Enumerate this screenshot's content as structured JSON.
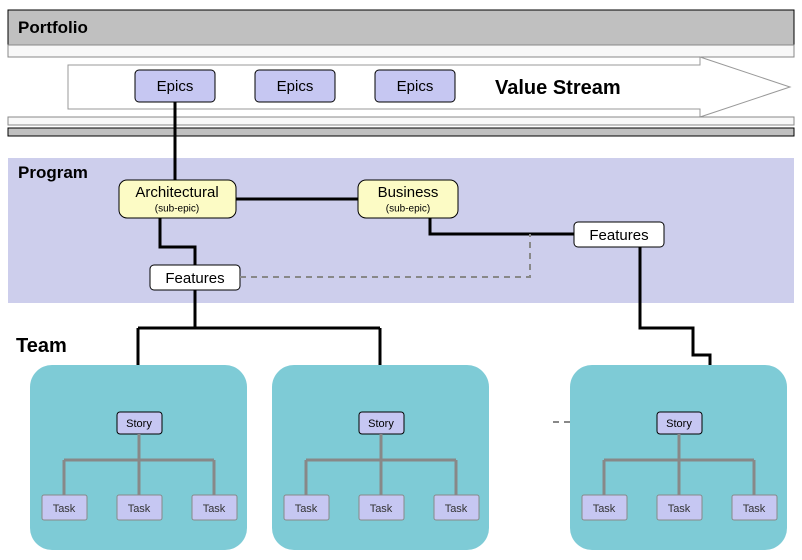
{
  "portfolio": {
    "title": "Portfolio",
    "epics": [
      "Epics",
      "Epics",
      "Epics"
    ],
    "value_stream_label": "Value Stream"
  },
  "program": {
    "title": "Program",
    "architectural": {
      "label": "Architectural",
      "sub": "(sub-epic)"
    },
    "business": {
      "label": "Business",
      "sub": "(sub-epic)"
    },
    "features_left": "Features",
    "features_right": "Features"
  },
  "team": {
    "title": "Team",
    "panels": [
      {
        "story": "Story",
        "tasks": [
          "Task",
          "Task",
          "Task"
        ]
      },
      {
        "story": "Story",
        "tasks": [
          "Task",
          "Task",
          "Task"
        ]
      },
      {
        "story": "Story",
        "tasks": [
          "Task",
          "Task",
          "Task"
        ]
      }
    ]
  }
}
